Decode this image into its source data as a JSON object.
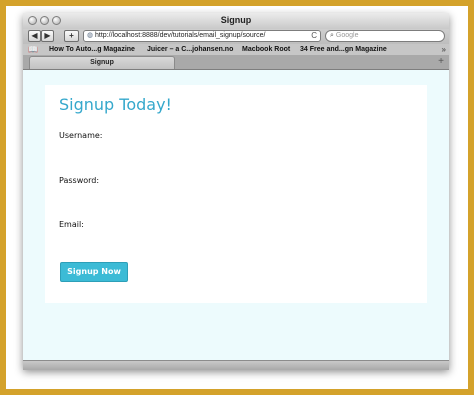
{
  "window": {
    "title": "Signup"
  },
  "toolbar": {
    "back_label": "◀",
    "forward_label": "▶",
    "add_label": "+",
    "url": "http://localhost:8888/dev/tutorials/email_signup/source/",
    "reload_label": "C",
    "search_placeholder": "Google"
  },
  "bookmarks": {
    "items": [
      "How To Auto...g Magazine",
      "Juicer – a C...johansen.no",
      "Macbook Root",
      "34 Free and...gn Magazine"
    ],
    "more_label": "»"
  },
  "tabs": {
    "items": [
      {
        "label": "Signup"
      }
    ],
    "add_label": "+"
  },
  "form": {
    "heading": "Signup Today!",
    "username_label": "Username:",
    "password_label": "Password:",
    "email_label": "Email:",
    "submit_label": "Signup Now"
  },
  "colors": {
    "heading": "#35a8cc",
    "button": "#3cbbd6",
    "page_background": "#edfbfd",
    "frame": "#d4a22b"
  }
}
